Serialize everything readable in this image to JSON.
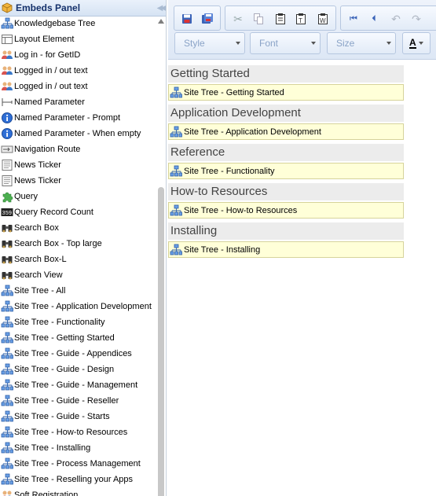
{
  "panel": {
    "title": "Embeds Panel",
    "items": [
      {
        "label": "Knowledgebase Tree",
        "icon": "sitemap-icon"
      },
      {
        "label": "Layout Element",
        "icon": "layout-icon"
      },
      {
        "label": "Log in - for GetID",
        "icon": "users-icon"
      },
      {
        "label": "Logged in / out text",
        "icon": "users-icon"
      },
      {
        "label": "Logged in / out text",
        "icon": "users-icon"
      },
      {
        "label": "Named Parameter",
        "icon": "parameter-icon"
      },
      {
        "label": "Named Parameter - Prompt",
        "icon": "info-icon"
      },
      {
        "label": "Named Parameter - When empty",
        "icon": "info-icon"
      },
      {
        "label": "Navigation Route",
        "icon": "route-icon"
      },
      {
        "label": "News Ticker",
        "icon": "news-icon"
      },
      {
        "label": "News Ticker",
        "icon": "news-icon"
      },
      {
        "label": "Query",
        "icon": "puzzle-icon"
      },
      {
        "label": "Query Record Count",
        "icon": "counter-icon"
      },
      {
        "label": "Search Box",
        "icon": "binoculars-icon"
      },
      {
        "label": "Search Box - Top large",
        "icon": "binoculars-icon"
      },
      {
        "label": "Search Box-L",
        "icon": "binoculars-icon"
      },
      {
        "label": "Search View",
        "icon": "binoculars-icon"
      },
      {
        "label": "Site Tree - All",
        "icon": "sitemap-icon"
      },
      {
        "label": "Site Tree - Application Development",
        "icon": "sitemap-icon"
      },
      {
        "label": "Site Tree - Functionality",
        "icon": "sitemap-icon"
      },
      {
        "label": "Site Tree - Getting Started",
        "icon": "sitemap-icon"
      },
      {
        "label": "Site Tree - Guide - Appendices",
        "icon": "sitemap-icon"
      },
      {
        "label": "Site Tree - Guide - Design",
        "icon": "sitemap-icon"
      },
      {
        "label": "Site Tree - Guide - Management",
        "icon": "sitemap-icon"
      },
      {
        "label": "Site Tree - Guide - Reseller",
        "icon": "sitemap-icon"
      },
      {
        "label": "Site Tree - Guide - Starts",
        "icon": "sitemap-icon"
      },
      {
        "label": "Site Tree - How-to Resources",
        "icon": "sitemap-icon"
      },
      {
        "label": "Site Tree - Installing",
        "icon": "sitemap-icon"
      },
      {
        "label": "Site Tree - Process Management",
        "icon": "sitemap-icon"
      },
      {
        "label": "Site Tree - Reselling your Apps",
        "icon": "sitemap-icon"
      },
      {
        "label": "Soft Registration",
        "icon": "users-icon"
      }
    ]
  },
  "toolbar": {
    "style_label": "Style",
    "font_label": "Font",
    "size_label": "Size",
    "text_color_label": "A"
  },
  "content": {
    "sections": [
      {
        "heading": "Getting Started",
        "embed": "Site Tree - Getting Started"
      },
      {
        "heading": "Application Development",
        "embed": "Site Tree - Application Development"
      },
      {
        "heading": "Reference",
        "embed": "Site Tree - Functionality"
      },
      {
        "heading": "How-to Resources",
        "embed": "Site Tree - How-to Resources"
      },
      {
        "heading": "Installing",
        "embed": "Site Tree - Installing"
      }
    ]
  },
  "colors": {
    "panel_header": "#d6e3f3",
    "embed_bg": "#ffffd8",
    "section_bg": "#ececec",
    "toolbar_bg": "#dde7f5"
  }
}
